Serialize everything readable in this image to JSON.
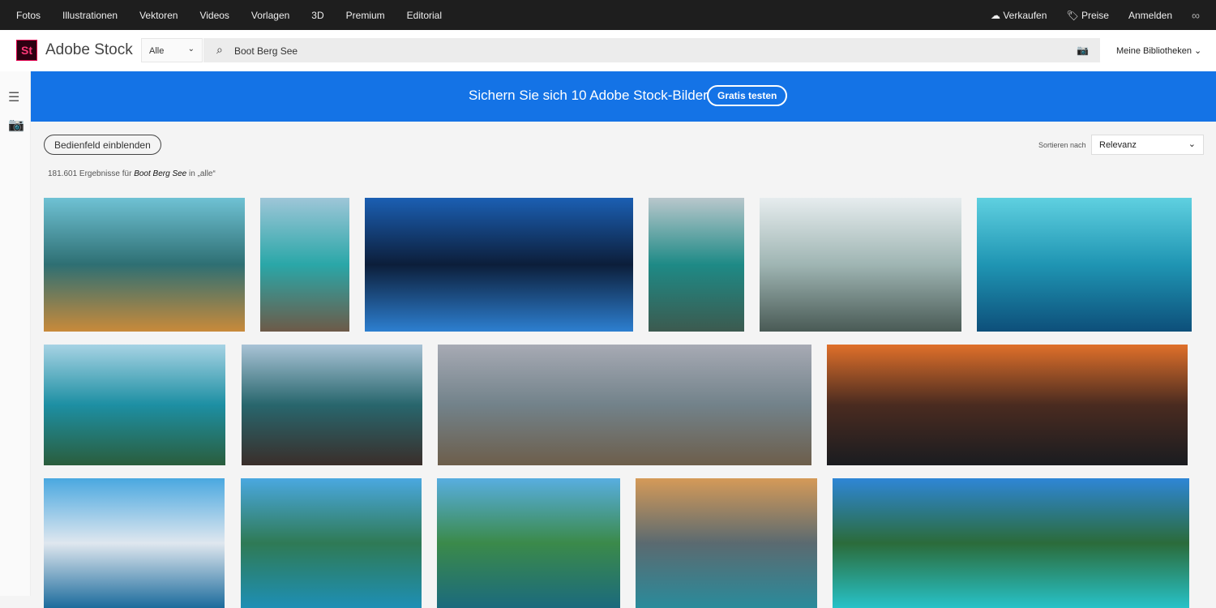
{
  "topnav": {
    "items": [
      "Fotos",
      "Illustrationen",
      "Vektoren",
      "Videos",
      "Vorlagen",
      "3D",
      "Premium",
      "Editorial"
    ],
    "sell": "Verkaufen",
    "prices": "Preise",
    "signin": "Anmelden"
  },
  "header": {
    "logo": "St",
    "brand": "Adobe Stock",
    "scope": "Alle",
    "query": "Boot Berg See",
    "libraries": "Meine Bibliotheken"
  },
  "banner": {
    "text": "Sichern Sie sich 10 Adobe Stock-Bilder",
    "button": "Gratis testen",
    "color": "#1473e6"
  },
  "toolbar": {
    "panel_button": "Bedienfeld einblenden",
    "sort_label": "Sortieren nach",
    "sort_value": "Relevanz"
  },
  "results": {
    "count": "181.601",
    "text1": " Ergebnisse für ",
    "query": "Boot Berg See",
    "text2": " in „alle“"
  },
  "images": [
    {
      "colors": [
        "#6fc2d4",
        "#2e6f73",
        "#c98a3a"
      ]
    },
    {
      "colors": [
        "#9ec6d8",
        "#2aa7a8",
        "#6d5a48"
      ]
    },
    {
      "colors": [
        "#1b5fb3",
        "#0c1e3a",
        "#2d7fd0"
      ]
    },
    {
      "colors": [
        "#b9c7cc",
        "#1e8a86",
        "#3c5a4f"
      ]
    },
    {
      "colors": [
        "#e6ecee",
        "#9fb5b3",
        "#495a55"
      ]
    },
    {
      "colors": [
        "#5fd0e0",
        "#1f95b3",
        "#0d4f7a"
      ]
    },
    {
      "colors": [
        "#a7d3e4",
        "#1d8fa3",
        "#2a5d3c"
      ]
    },
    {
      "colors": [
        "#a9c3d6",
        "#28666d",
        "#3a2e2a"
      ]
    },
    {
      "colors": [
        "#a7aab4",
        "#72828a",
        "#6d5e4b"
      ]
    },
    {
      "colors": [
        "#e0702a",
        "#4a2b20",
        "#1a1c20"
      ]
    },
    {
      "colors": [
        "#4aa8e0",
        "#dfe7ef",
        "#1b6b9c"
      ]
    },
    {
      "colors": [
        "#4aa8e0",
        "#2f7a55",
        "#1e8fb5"
      ]
    },
    {
      "colors": [
        "#58aee0",
        "#3b8a4a",
        "#1b6a7d"
      ]
    },
    {
      "colors": [
        "#d59a58",
        "#5b6a70",
        "#2a8b9b"
      ]
    },
    {
      "colors": [
        "#2e86d6",
        "#2b6b3a",
        "#27c2c8"
      ]
    }
  ]
}
